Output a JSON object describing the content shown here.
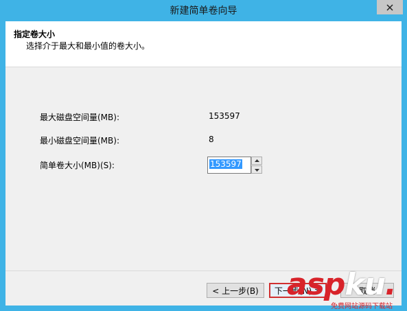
{
  "window": {
    "title": "新建简单卷向导",
    "close_icon": "close-icon"
  },
  "header": {
    "title": "指定卷大小",
    "subtitle": "选择介于最大和最小值的卷大小。"
  },
  "fields": {
    "max_label": "最大磁盘空间量(MB):",
    "max_value": "153597",
    "min_label": "最小磁盘空间量(MB):",
    "min_value": "8",
    "size_label": "简单卷大小(MB)(S):",
    "size_value": "153597"
  },
  "buttons": {
    "back": "< 上一步(B)",
    "next": "下一步(N) >",
    "cancel": "取消"
  },
  "watermark": {
    "brand_a": "asp",
    "brand_b": "ku",
    "brand_c": ".",
    "sub": "免费网站源码下载站"
  },
  "colors": {
    "frame": "#3fb3e6",
    "selection": "#3399ff",
    "watermark": "#d8232a"
  }
}
